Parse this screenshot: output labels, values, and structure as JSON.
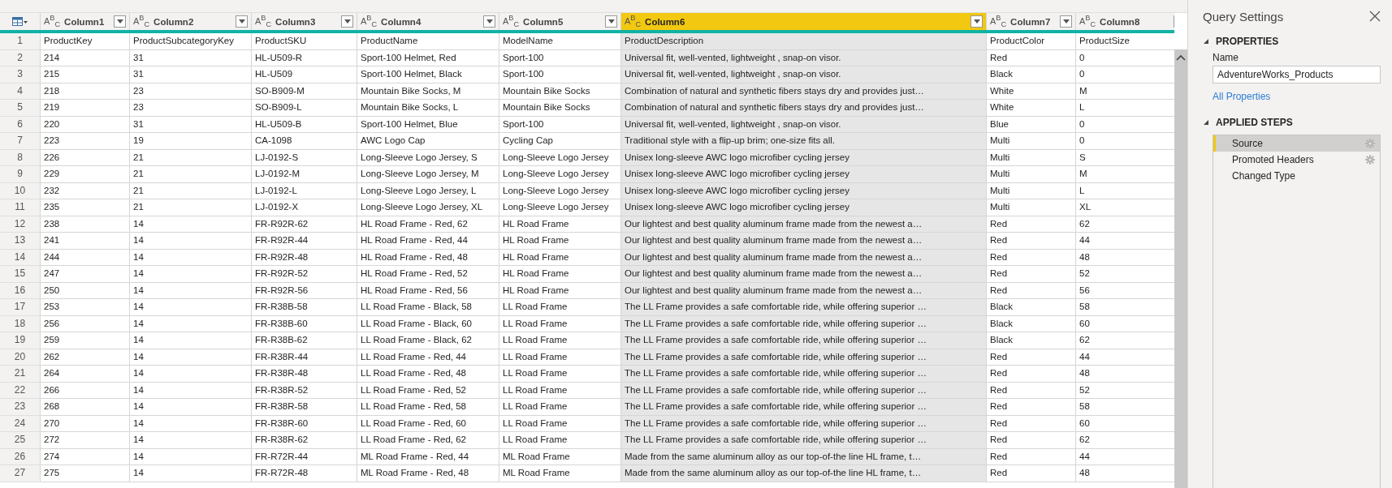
{
  "table": {
    "columns": [
      {
        "name": "Column1",
        "type_icon": "A$^{B}$$_{C}$",
        "selected": false
      },
      {
        "name": "Column2",
        "type_icon": "A$^{B}$$_{C}$",
        "selected": false
      },
      {
        "name": "Column3",
        "type_icon": "A$^{B}$$_{C}$",
        "selected": false
      },
      {
        "name": "Column4",
        "type_icon": "A$^{B}$$_{C}$",
        "selected": false
      },
      {
        "name": "Column5",
        "type_icon": "A$^{B}$$_{C}$",
        "selected": false
      },
      {
        "name": "Column6",
        "type_icon": "A$^{B}$$_{C}$",
        "selected": true
      },
      {
        "name": "Column7",
        "type_icon": "A$^{B}$$_{C}$",
        "selected": false
      },
      {
        "name": "Column8",
        "type_icon": "A$^{B}$$_{C}$",
        "selected": false
      }
    ],
    "rows": [
      {
        "n": "1",
        "cells": [
          "ProductKey",
          "ProductSubcategoryKey",
          "ProductSKU",
          "ProductName",
          "ModelName",
          "ProductDescription",
          "ProductColor",
          "ProductSize"
        ]
      },
      {
        "n": "2",
        "cells": [
          "214",
          "31",
          "HL-U509-R",
          "Sport-100 Helmet, Red",
          "Sport-100",
          "Universal fit, well-vented, lightweight , snap-on visor.",
          "Red",
          "0"
        ]
      },
      {
        "n": "3",
        "cells": [
          "215",
          "31",
          "HL-U509",
          "Sport-100 Helmet, Black",
          "Sport-100",
          "Universal fit, well-vented, lightweight , snap-on visor.",
          "Black",
          "0"
        ]
      },
      {
        "n": "4",
        "cells": [
          "218",
          "23",
          "SO-B909-M",
          "Mountain Bike Socks, M",
          "Mountain Bike Socks",
          "Combination of natural and synthetic fibers stays dry and provides just…",
          "White",
          "M"
        ]
      },
      {
        "n": "5",
        "cells": [
          "219",
          "23",
          "SO-B909-L",
          "Mountain Bike Socks, L",
          "Mountain Bike Socks",
          "Combination of natural and synthetic fibers stays dry and provides just…",
          "White",
          "L"
        ]
      },
      {
        "n": "6",
        "cells": [
          "220",
          "31",
          "HL-U509-B",
          "Sport-100 Helmet, Blue",
          "Sport-100",
          "Universal fit, well-vented, lightweight , snap-on visor.",
          "Blue",
          "0"
        ]
      },
      {
        "n": "7",
        "cells": [
          "223",
          "19",
          "CA-1098",
          "AWC Logo Cap",
          "Cycling Cap",
          "Traditional style with a flip-up brim; one-size fits all.",
          "Multi",
          "0"
        ]
      },
      {
        "n": "8",
        "cells": [
          "226",
          "21",
          "LJ-0192-S",
          "Long-Sleeve Logo Jersey, S",
          "Long-Sleeve Logo Jersey",
          "Unisex long-sleeve AWC logo microfiber cycling jersey",
          "Multi",
          "S"
        ]
      },
      {
        "n": "9",
        "cells": [
          "229",
          "21",
          "LJ-0192-M",
          "Long-Sleeve Logo Jersey, M",
          "Long-Sleeve Logo Jersey",
          "Unisex long-sleeve AWC logo microfiber cycling jersey",
          "Multi",
          "M"
        ]
      },
      {
        "n": "10",
        "cells": [
          "232",
          "21",
          "LJ-0192-L",
          "Long-Sleeve Logo Jersey, L",
          "Long-Sleeve Logo Jersey",
          "Unisex long-sleeve AWC logo microfiber cycling jersey",
          "Multi",
          "L"
        ]
      },
      {
        "n": "11",
        "cells": [
          "235",
          "21",
          "LJ-0192-X",
          "Long-Sleeve Logo Jersey, XL",
          "Long-Sleeve Logo Jersey",
          "Unisex long-sleeve AWC logo microfiber cycling jersey",
          "Multi",
          "XL"
        ]
      },
      {
        "n": "12",
        "cells": [
          "238",
          "14",
          "FR-R92R-62",
          "HL Road Frame - Red, 62",
          "HL Road Frame",
          "Our lightest and best quality aluminum frame made from the newest a…",
          "Red",
          "62"
        ]
      },
      {
        "n": "13",
        "cells": [
          "241",
          "14",
          "FR-R92R-44",
          "HL Road Frame - Red, 44",
          "HL Road Frame",
          "Our lightest and best quality aluminum frame made from the newest a…",
          "Red",
          "44"
        ]
      },
      {
        "n": "14",
        "cells": [
          "244",
          "14",
          "FR-R92R-48",
          "HL Road Frame - Red, 48",
          "HL Road Frame",
          "Our lightest and best quality aluminum frame made from the newest a…",
          "Red",
          "48"
        ]
      },
      {
        "n": "15",
        "cells": [
          "247",
          "14",
          "FR-R92R-52",
          "HL Road Frame - Red, 52",
          "HL Road Frame",
          "Our lightest and best quality aluminum frame made from the newest a…",
          "Red",
          "52"
        ]
      },
      {
        "n": "16",
        "cells": [
          "250",
          "14",
          "FR-R92R-56",
          "HL Road Frame - Red, 56",
          "HL Road Frame",
          "Our lightest and best quality aluminum frame made from the newest a…",
          "Red",
          "56"
        ]
      },
      {
        "n": "17",
        "cells": [
          "253",
          "14",
          "FR-R38B-58",
          "LL Road Frame - Black, 58",
          "LL Road Frame",
          "The LL Frame provides a safe comfortable ride, while offering superior …",
          "Black",
          "58"
        ]
      },
      {
        "n": "18",
        "cells": [
          "256",
          "14",
          "FR-R38B-60",
          "LL Road Frame - Black, 60",
          "LL Road Frame",
          "The LL Frame provides a safe comfortable ride, while offering superior …",
          "Black",
          "60"
        ]
      },
      {
        "n": "19",
        "cells": [
          "259",
          "14",
          "FR-R38B-62",
          "LL Road Frame - Black, 62",
          "LL Road Frame",
          "The LL Frame provides a safe comfortable ride, while offering superior …",
          "Black",
          "62"
        ]
      },
      {
        "n": "20",
        "cells": [
          "262",
          "14",
          "FR-R38R-44",
          "LL Road Frame - Red, 44",
          "LL Road Frame",
          "The LL Frame provides a safe comfortable ride, while offering superior …",
          "Red",
          "44"
        ]
      },
      {
        "n": "21",
        "cells": [
          "264",
          "14",
          "FR-R38R-48",
          "LL Road Frame - Red, 48",
          "LL Road Frame",
          "The LL Frame provides a safe comfortable ride, while offering superior …",
          "Red",
          "48"
        ]
      },
      {
        "n": "22",
        "cells": [
          "266",
          "14",
          "FR-R38R-52",
          "LL Road Frame - Red, 52",
          "LL Road Frame",
          "The LL Frame provides a safe comfortable ride, while offering superior …",
          "Red",
          "52"
        ]
      },
      {
        "n": "23",
        "cells": [
          "268",
          "14",
          "FR-R38R-58",
          "LL Road Frame - Red, 58",
          "LL Road Frame",
          "The LL Frame provides a safe comfortable ride, while offering superior …",
          "Red",
          "58"
        ]
      },
      {
        "n": "24",
        "cells": [
          "270",
          "14",
          "FR-R38R-60",
          "LL Road Frame - Red, 60",
          "LL Road Frame",
          "The LL Frame provides a safe comfortable ride, while offering superior …",
          "Red",
          "60"
        ]
      },
      {
        "n": "25",
        "cells": [
          "272",
          "14",
          "FR-R38R-62",
          "LL Road Frame - Red, 62",
          "LL Road Frame",
          "The LL Frame provides a safe comfortable ride, while offering superior …",
          "Red",
          "62"
        ]
      },
      {
        "n": "26",
        "cells": [
          "274",
          "14",
          "FR-R72R-44",
          "ML Road Frame - Red, 44",
          "ML Road Frame",
          "Made from the same aluminum alloy as our top-of-the line HL frame, t…",
          "Red",
          "44"
        ]
      },
      {
        "n": "27",
        "cells": [
          "275",
          "14",
          "FR-R72R-48",
          "ML Road Frame - Red, 48",
          "ML Road Frame",
          "Made from the same aluminum alloy as our top-of-the line HL frame, t…",
          "Red",
          "48"
        ]
      }
    ]
  },
  "query_settings": {
    "title": "Query Settings",
    "properties": {
      "heading": "PROPERTIES",
      "expanded": true,
      "name_label": "Name",
      "name_value": "AdventureWorks_Products",
      "link": "All Properties"
    },
    "applied_steps": {
      "heading": "APPLIED STEPS",
      "expanded": true,
      "steps": [
        {
          "label": "Source",
          "selected": true,
          "has_settings": true
        },
        {
          "label": "Promoted Headers",
          "selected": false,
          "has_settings": true
        },
        {
          "label": "Changed Type",
          "selected": false,
          "has_settings": false
        }
      ]
    }
  }
}
